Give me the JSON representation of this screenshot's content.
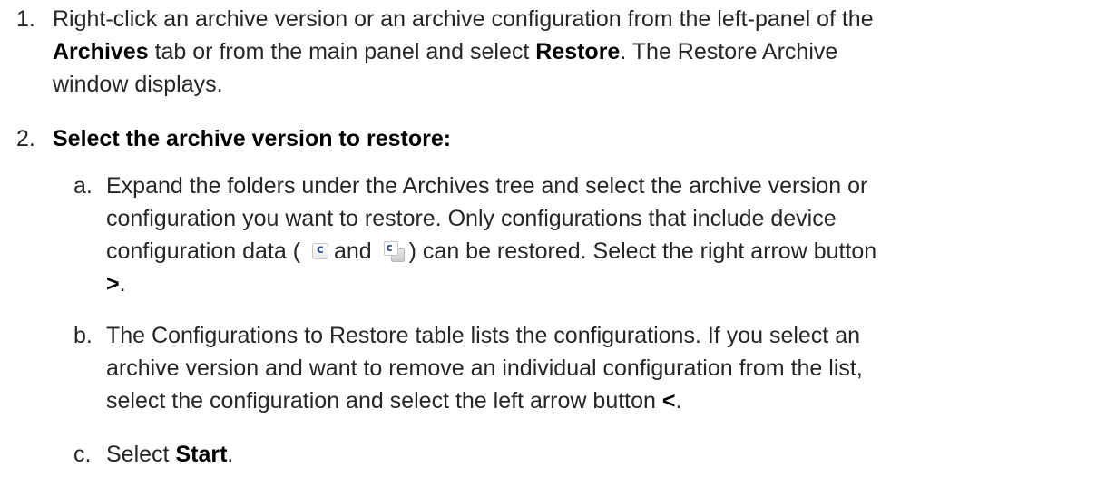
{
  "steps": [
    {
      "number": "1.",
      "lines": [
        {
          "t1": "Right-click an archive version or an archive configuration from the left-panel of the"
        },
        {
          "b1": "Archives",
          "t1": " tab or from the main panel and select ",
          "b2": "Restore",
          "t2": ". The Restore Archive"
        },
        {
          "t1": "window displays."
        }
      ]
    },
    {
      "number": "2.",
      "heading": "Select the archive version to restore:",
      "substeps": [
        {
          "letter": "a.",
          "lines": [
            "Expand the folders under the Archives tree and select the archive version or",
            "configuration you want to restore. Only configurations that include device"
          ],
          "icon_line": {
            "before": "configuration data (",
            "icon1": "config-icon",
            "middle": "and",
            "icon2": "config-group-icon",
            "after": ") can be restored. Select the right arrow button"
          },
          "final_bold": ">",
          "final_text": "."
        },
        {
          "letter": "b.",
          "lines": [
            "The Configurations to Restore table lists the configurations. If you select an",
            "archive version and want to remove an individual configuration from the list,"
          ],
          "last_text": "select the configuration and select the left arrow button ",
          "last_bold": "<",
          "last_end": "."
        },
        {
          "letter": "c.",
          "text": "Select ",
          "bold": "Start",
          "end": "."
        }
      ]
    }
  ]
}
